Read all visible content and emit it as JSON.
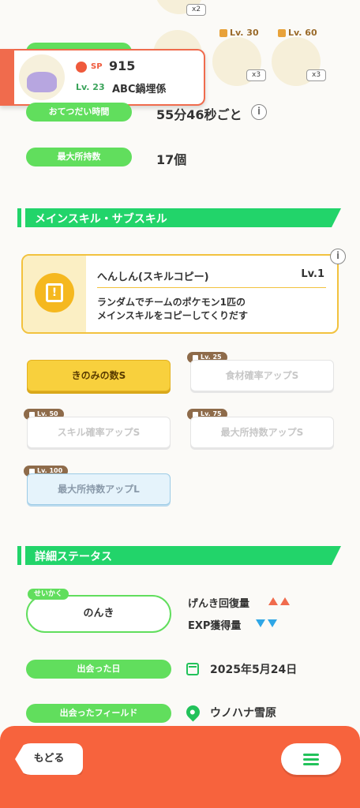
{
  "top_items": {
    "item1_count": "x2",
    "item2_count": "x3",
    "item2_level": "Lv. 30",
    "item3_count": "x3",
    "item3_level": "Lv. 60"
  },
  "profile": {
    "sp_label": "SP",
    "sp_value": "915",
    "level": "Lv. 23",
    "nickname": "ABC鍋埋係"
  },
  "stats": {
    "help_time_label": "おてつだい時間",
    "help_time_value": "55分46秒ごと",
    "max_carry_label": "最大所持数",
    "max_carry_value": "17個",
    "info_glyph": "i"
  },
  "skills_section": {
    "title": "メインスキル・サブスキル",
    "main_skill": {
      "name": "へんしん(スキルコピー)",
      "level": "Lv.1",
      "description": "ランダムでチームのポケモン1匹の\nメインスキルをコピーしてくりだす",
      "icon_glyph": "!"
    },
    "sub_skills": [
      {
        "label": "きのみの数S",
        "unlock": ""
      },
      {
        "label": "食材確率アップS",
        "unlock": "Lv. 25"
      },
      {
        "label": "スキル確率アップS",
        "unlock": "Lv. 50"
      },
      {
        "label": "最大所持数アップS",
        "unlock": "Lv. 75"
      },
      {
        "label": "最大所持数アップL",
        "unlock": "Lv. 100"
      }
    ]
  },
  "details_section": {
    "title": "詳細ステータス",
    "nature_tag": "せいかく",
    "nature_value": "のんき",
    "energy_label": "げんき回復量",
    "exp_label": "EXP獲得量",
    "met_date_label": "出会った日",
    "met_date_value": "2025年5月24日",
    "met_field_label": "出会ったフィールド",
    "met_field_value": "ウノハナ雪原"
  },
  "footer": {
    "back_label": "もどる"
  },
  "colors": {
    "accent_green": "#22d46a",
    "pill_green": "#61de5d",
    "footer_orange": "#f7633d",
    "gold": "#f8d03d"
  }
}
